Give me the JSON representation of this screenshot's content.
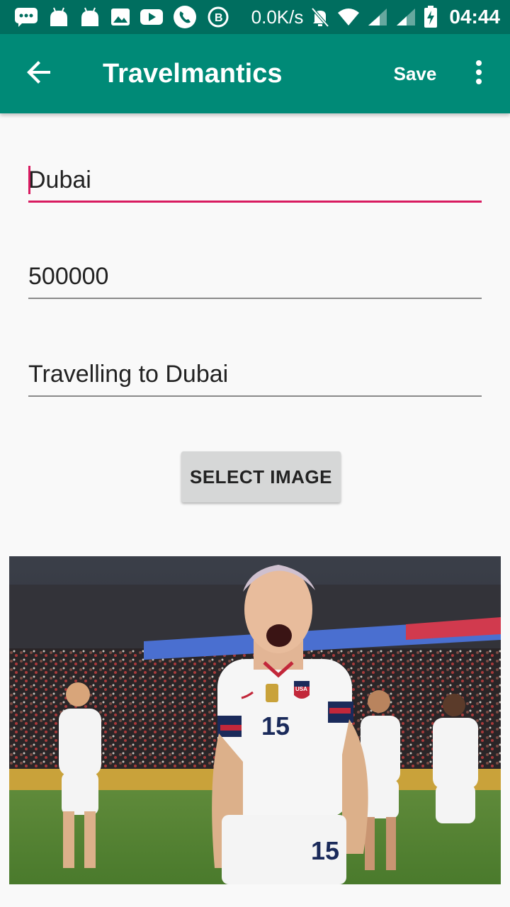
{
  "status_bar": {
    "network_speed": "0.0K/s",
    "time": "04:44",
    "icons": [
      "messages-icon",
      "android-icon",
      "android-icon",
      "image-icon",
      "youtube-icon",
      "phone-icon",
      "b-icon",
      "mute-icon",
      "wifi-icon",
      "signal-icon",
      "signal-icon",
      "battery-charging-icon"
    ]
  },
  "app_bar": {
    "title": "Travelmantics",
    "save_label": "Save",
    "back_icon": "arrow-back-icon",
    "overflow_icon": "more-vert-icon",
    "color": "#008a77"
  },
  "form": {
    "title_value": "Dubai",
    "price_value": "500000",
    "description_value": "Travelling to Dubai",
    "accent_color": "#d81b60"
  },
  "select_image_label": "SELECT IMAGE",
  "image": {
    "jersey_number": "15",
    "jersey_badge": "USA"
  }
}
